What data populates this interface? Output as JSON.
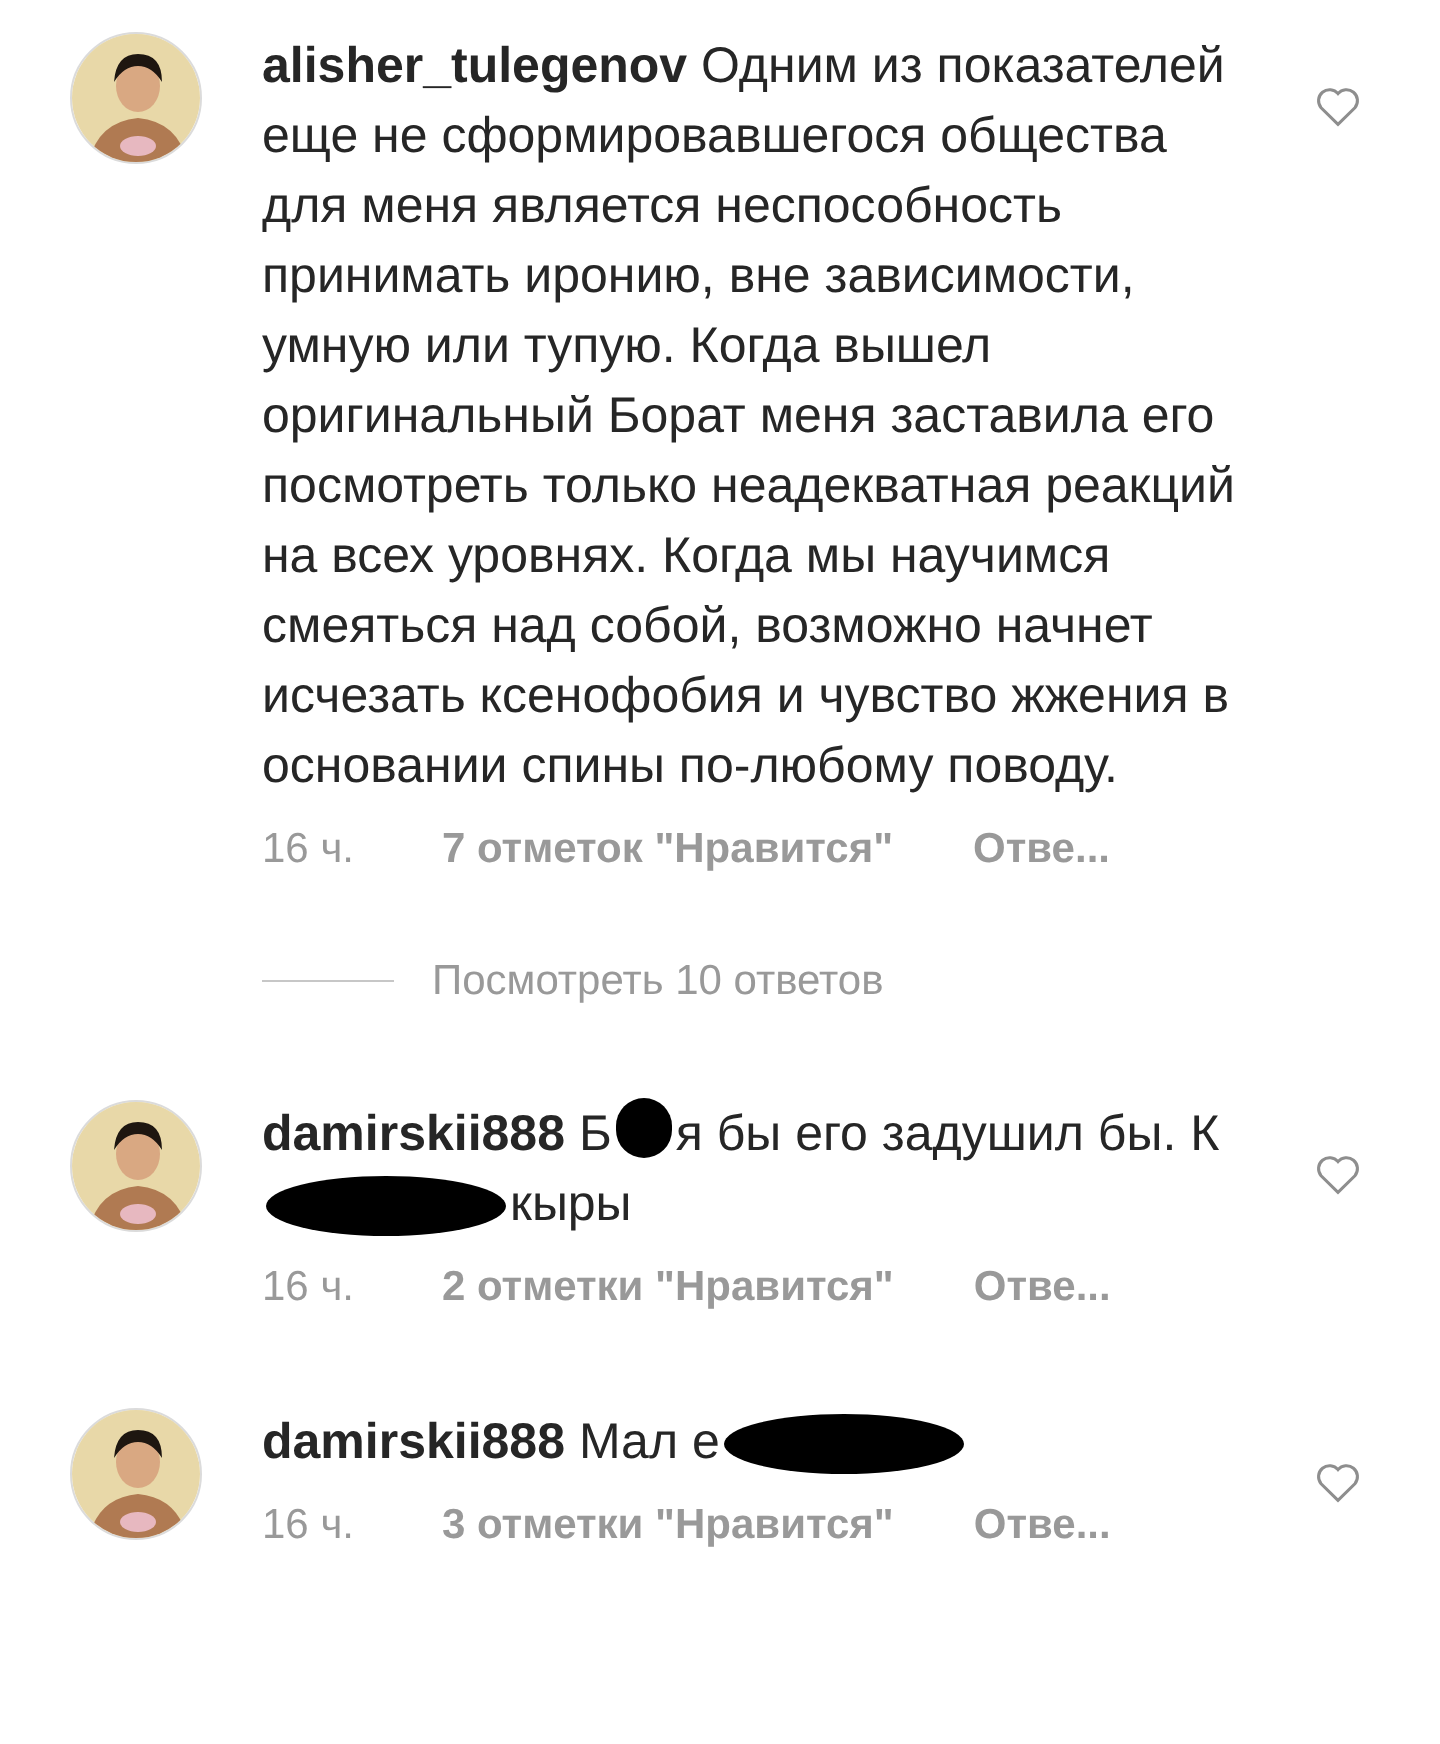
{
  "comments": [
    {
      "username": "alisher_tulegenov",
      "avatar": {
        "kind": "picture"
      },
      "parts": [
        {
          "kind": "text",
          "text": "Одним из показателей еще не сформировавшегося общества для меня является неспособность принимать иронию, вне зависимости, умную или тупую. Когда вышел оригинальный Борат меня заставила его посмотреть только неадекватная реакций на всех уровнях. Когда мы научимся смеяться над собой, возможно начнет исчезать ксенофобия и чувство жжения в основании спины по-любому поводу."
        }
      ],
      "time": "16 ч.",
      "likes": "7 отметок \"Нравится\"",
      "reply": "Отве...",
      "liked": false,
      "view_replies": "Посмотреть 10 ответов"
    },
    {
      "username": "damirskii888",
      "avatar": {
        "kind": "picture"
      },
      "parts": [
        {
          "kind": "text",
          "text": "Б"
        },
        {
          "kind": "redacted_short"
        },
        {
          "kind": "text",
          "text": "я бы его задушил бы. К"
        },
        {
          "kind": "redacted_long"
        },
        {
          "kind": "text",
          "text": "кыры"
        }
      ],
      "time": "16 ч.",
      "likes": "2 отметки \"Нравится\"",
      "reply": "Отве...",
      "liked": false
    },
    {
      "username": "damirskii888",
      "avatar": {
        "kind": "picture"
      },
      "parts": [
        {
          "kind": "text",
          "text": "Мал е"
        },
        {
          "kind": "redacted_long"
        }
      ],
      "time": "16 ч.",
      "likes": "3 отметки \"Нравится\"",
      "reply": "Отве...",
      "liked": false
    }
  ]
}
